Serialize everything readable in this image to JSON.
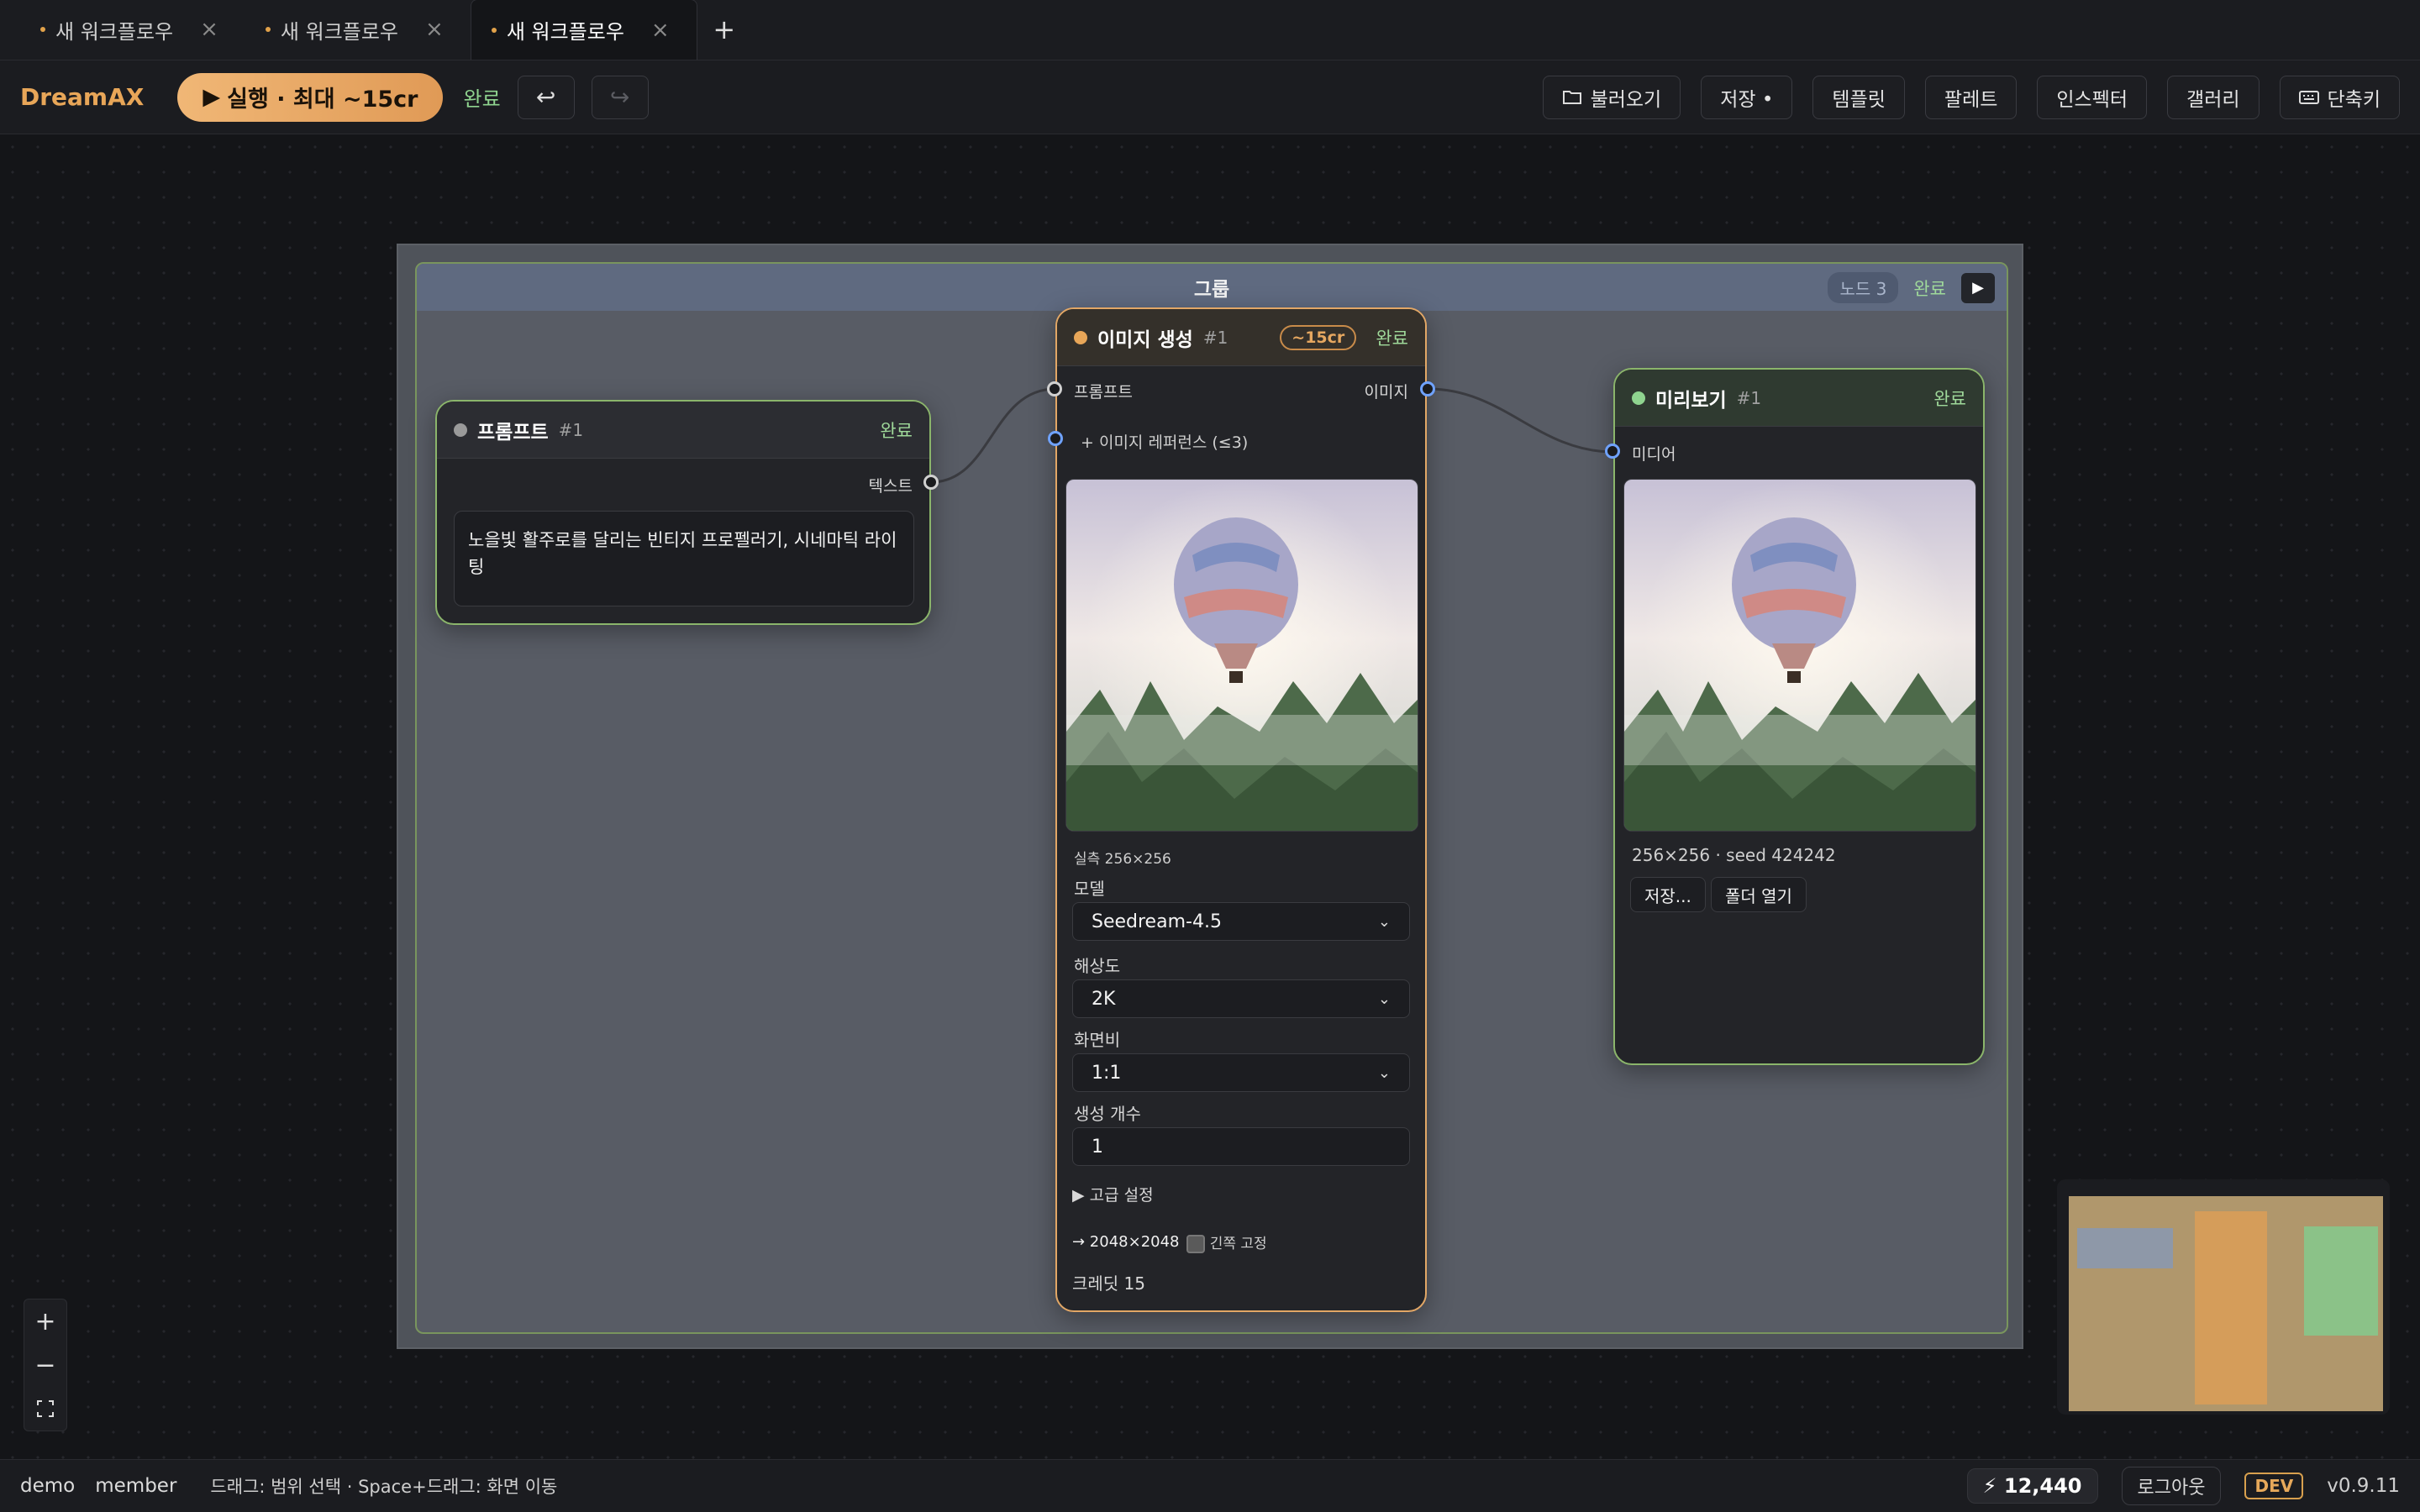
{
  "tabs": [
    {
      "label": "새 워크플로우"
    },
    {
      "label": "새 워크플로우"
    },
    {
      "label": "새 워크플로우"
    }
  ],
  "toolbar": {
    "brand": "DreamAX",
    "run_label": "실행 · 최대 ~15cr",
    "status": "완료",
    "buttons": {
      "load": "불러오기",
      "save": "저장 •",
      "templates": "템플릿",
      "palette": "팔레트",
      "inspector": "인스펙터",
      "gallery": "갤러리",
      "shortcuts": "단축키"
    }
  },
  "group": {
    "title": "그룹",
    "node_count": "노드 3",
    "status": "완료"
  },
  "prompt_node": {
    "title": "프롬프트",
    "num": "#1",
    "status": "완료",
    "output_label": "텍스트",
    "text": "노을빛 활주로를 달리는 빈티지 프로펠러기, 시네마틱 라이팅"
  },
  "gen_node": {
    "title": "이미지 생성",
    "num": "#1",
    "cost": "~15cr",
    "status": "완료",
    "input_prompt": "프롬프트",
    "input_refs": "+ 이미지 레퍼런스 (≤3)",
    "output_image": "이미지",
    "actual_size": "실측 256×256",
    "model_label": "모델",
    "model_value": "Seedream-4.5",
    "resolution_label": "해상도",
    "resolution_value": "2K",
    "aspect_label": "화면비",
    "aspect_value": "1:1",
    "count_label": "생성 개수",
    "count_value": "1",
    "advanced": "▶ 고급 설정",
    "output_size": "→ 2048×2048",
    "lock_label": "긴쪽 고정",
    "credits": "크레딧 15"
  },
  "preview_node": {
    "title": "미리보기",
    "num": "#1",
    "status": "완료",
    "input_label": "미디어",
    "info": "256×256 · seed 424242",
    "save_btn": "저장...",
    "folder_btn": "폴더 열기"
  },
  "statusbar": {
    "user": "demo",
    "role": "member",
    "hint": "드래그: 범위 선택 · Space+드래그: 화면 이동",
    "credits": "⚡ 12,440",
    "logout": "로그아웃",
    "env": "DEV",
    "version": "v0.9.11"
  },
  "colors": {
    "accent": "#e8a658",
    "success": "#9fd99a",
    "node_border": "#8bb56b",
    "port_blue": "#6fa2ff"
  }
}
